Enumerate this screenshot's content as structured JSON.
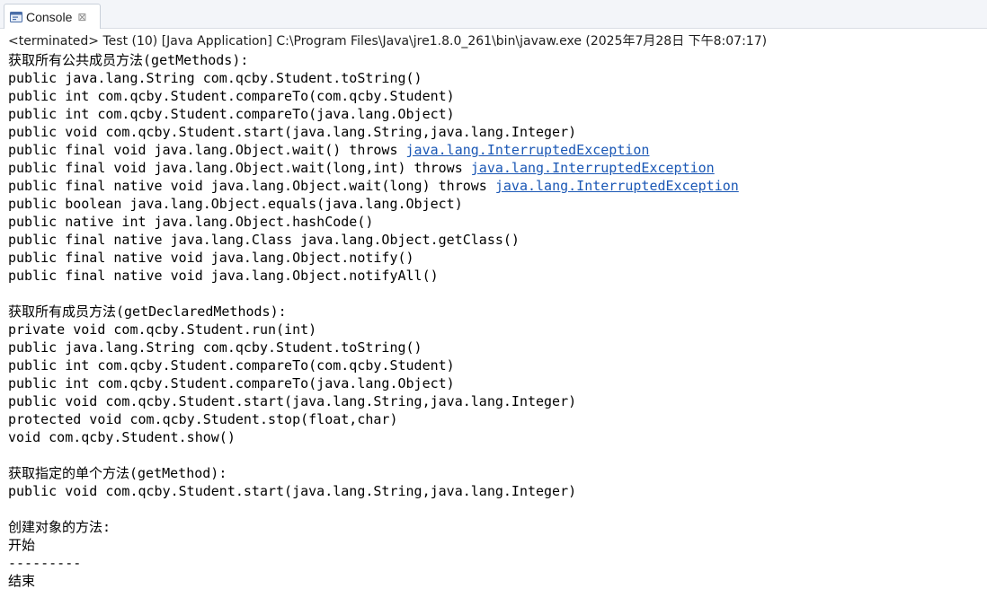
{
  "tab": {
    "icon": "console-icon",
    "label": "Console",
    "close_glyph": "⊠"
  },
  "status": "<terminated> Test (10) [Java Application] C:\\Program Files\\Java\\jre1.8.0_261\\bin\\javaw.exe (2025年7月28日 下午8:07:17)",
  "link_color": "#1a57b5",
  "lines": [
    {
      "text": "获取所有公共成员方法(getMethods):"
    },
    {
      "text": "public java.lang.String com.qcby.Student.toString()"
    },
    {
      "text": "public int com.qcby.Student.compareTo(com.qcby.Student)"
    },
    {
      "text": "public int com.qcby.Student.compareTo(java.lang.Object)"
    },
    {
      "text": "public void com.qcby.Student.start(java.lang.String,java.lang.Integer)"
    },
    {
      "text": "public final void java.lang.Object.wait() throws ",
      "link": "java.lang.InterruptedException"
    },
    {
      "text": "public final void java.lang.Object.wait(long,int) throws ",
      "link": "java.lang.InterruptedException"
    },
    {
      "text": "public final native void java.lang.Object.wait(long) throws ",
      "link": "java.lang.InterruptedException"
    },
    {
      "text": "public boolean java.lang.Object.equals(java.lang.Object)"
    },
    {
      "text": "public native int java.lang.Object.hashCode()"
    },
    {
      "text": "public final native java.lang.Class java.lang.Object.getClass()"
    },
    {
      "text": "public final native void java.lang.Object.notify()"
    },
    {
      "text": "public final native void java.lang.Object.notifyAll()"
    },
    {
      "text": ""
    },
    {
      "text": "获取所有成员方法(getDeclaredMethods):"
    },
    {
      "text": "private void com.qcby.Student.run(int)"
    },
    {
      "text": "public java.lang.String com.qcby.Student.toString()"
    },
    {
      "text": "public int com.qcby.Student.compareTo(com.qcby.Student)"
    },
    {
      "text": "public int com.qcby.Student.compareTo(java.lang.Object)"
    },
    {
      "text": "public void com.qcby.Student.start(java.lang.String,java.lang.Integer)"
    },
    {
      "text": "protected void com.qcby.Student.stop(float,char)"
    },
    {
      "text": "void com.qcby.Student.show()"
    },
    {
      "text": ""
    },
    {
      "text": "获取指定的单个方法(getMethod):"
    },
    {
      "text": "public void com.qcby.Student.start(java.lang.String,java.lang.Integer)"
    },
    {
      "text": ""
    },
    {
      "text": "创建对象的方法:"
    },
    {
      "text": "开始"
    },
    {
      "text": "---------"
    },
    {
      "text": "结束"
    }
  ]
}
